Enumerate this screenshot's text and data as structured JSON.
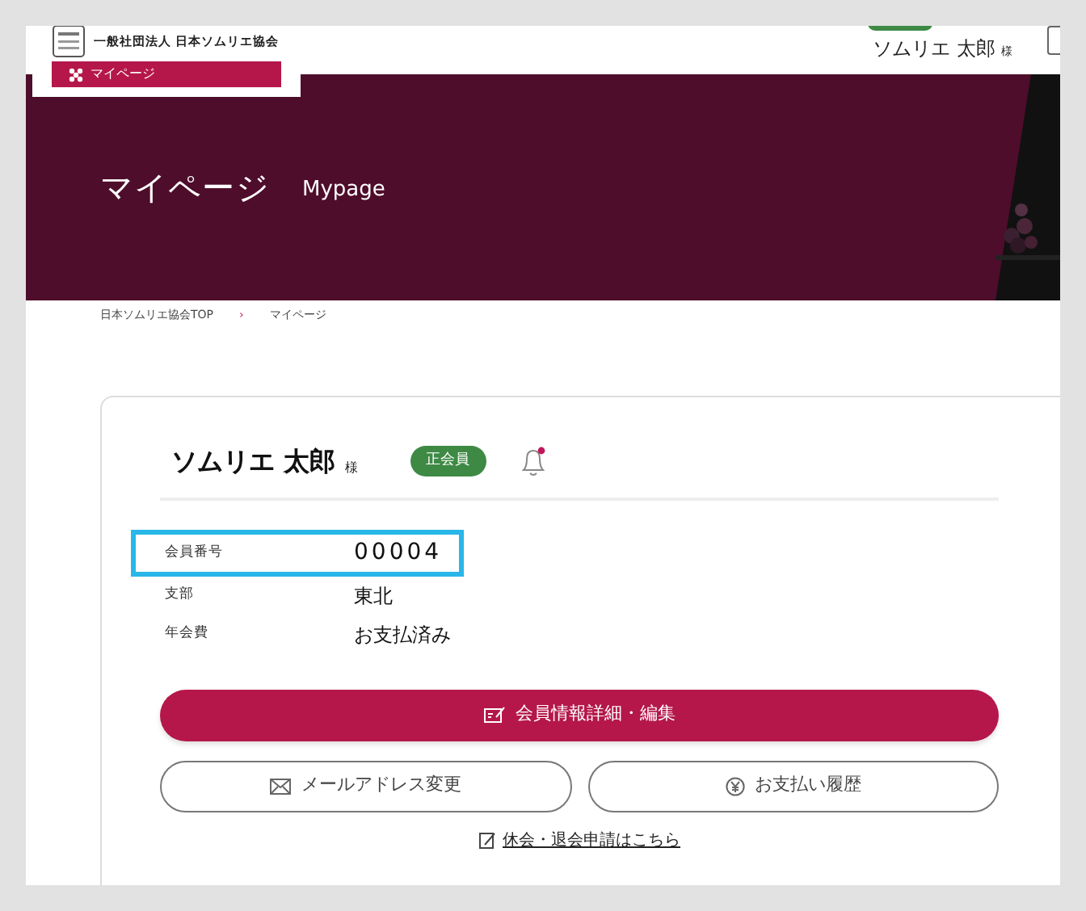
{
  "header": {
    "org_name": "一般社団法人 日本ソムリエ協会",
    "menu_button": "マイページ",
    "user_name": "ソムリエ 太郎",
    "user_suffix": "様"
  },
  "banner": {
    "title": "マイページ",
    "subtitle": "Mypage",
    "kind": "picture"
  },
  "breadcrumb": [
    {
      "label": "日本ソムリエ協会TOP",
      "separator": "›"
    },
    {
      "label": "マイページ"
    }
  ],
  "profile": {
    "name": "ソムリエ 太郎",
    "suffix": "様",
    "badge": "正会員",
    "notification_unread": true,
    "fields": [
      {
        "label": "会員番号",
        "value": "00004",
        "highlighted": true
      },
      {
        "label": "支部",
        "value": "東北",
        "highlighted": false
      },
      {
        "label": "年会費",
        "value": "お支払済み",
        "highlighted": false
      }
    ],
    "primary_button": "会員情報詳細・編集",
    "buttons": [
      {
        "label": "メールアドレス変更",
        "kind": "mail"
      },
      {
        "label": "お支払い履歴",
        "kind": "yen"
      }
    ],
    "link": "休会・退会申請はこちら"
  }
}
